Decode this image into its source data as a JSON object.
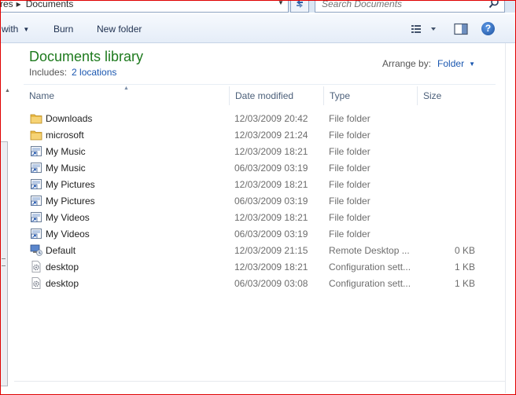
{
  "address_bar": {
    "prev_segment": "res",
    "current": "Documents",
    "search_placeholder": "Search Documents"
  },
  "toolbar": {
    "open_with": "with",
    "burn": "Burn",
    "new_folder": "New folder"
  },
  "library": {
    "title": "Documents library",
    "includes_label": "Includes:",
    "locations_link": "2 locations",
    "arrange_label": "Arrange by:",
    "arrange_value": "Folder"
  },
  "columns": {
    "name": "Name",
    "date": "Date modified",
    "type": "Type",
    "size": "Size"
  },
  "files": [
    {
      "name": "Downloads",
      "date": "12/03/2009 20:42",
      "type": "File folder",
      "size": "",
      "icon": "folder-icon"
    },
    {
      "name": "microsoft",
      "date": "12/03/2009 21:24",
      "type": "File folder",
      "size": "",
      "icon": "folder-icon"
    },
    {
      "name": "My Music",
      "date": "12/03/2009 18:21",
      "type": "File folder",
      "size": "",
      "icon": "shortcut-icon"
    },
    {
      "name": "My Music",
      "date": "06/03/2009 03:19",
      "type": "File folder",
      "size": "",
      "icon": "shortcut-icon"
    },
    {
      "name": "My Pictures",
      "date": "12/03/2009 18:21",
      "type": "File folder",
      "size": "",
      "icon": "shortcut-icon"
    },
    {
      "name": "My Pictures",
      "date": "06/03/2009 03:19",
      "type": "File folder",
      "size": "",
      "icon": "shortcut-icon"
    },
    {
      "name": "My Videos",
      "date": "12/03/2009 18:21",
      "type": "File folder",
      "size": "",
      "icon": "shortcut-icon"
    },
    {
      "name": "My Videos",
      "date": "06/03/2009 03:19",
      "type": "File folder",
      "size": "",
      "icon": "shortcut-icon"
    },
    {
      "name": "Default",
      "date": "12/03/2009 21:15",
      "type": "Remote Desktop ...",
      "size": "0 KB",
      "icon": "remote-desktop-icon"
    },
    {
      "name": "desktop",
      "date": "12/03/2009 18:21",
      "type": "Configuration sett...",
      "size": "1 KB",
      "icon": "config-file-icon"
    },
    {
      "name": "desktop",
      "date": "06/03/2009 03:08",
      "type": "Configuration sett...",
      "size": "1 KB",
      "icon": "config-file-icon"
    }
  ],
  "colors": {
    "title_green": "#1e7a1e",
    "link_blue": "#1a57b0",
    "frame_red": "#e00000"
  }
}
